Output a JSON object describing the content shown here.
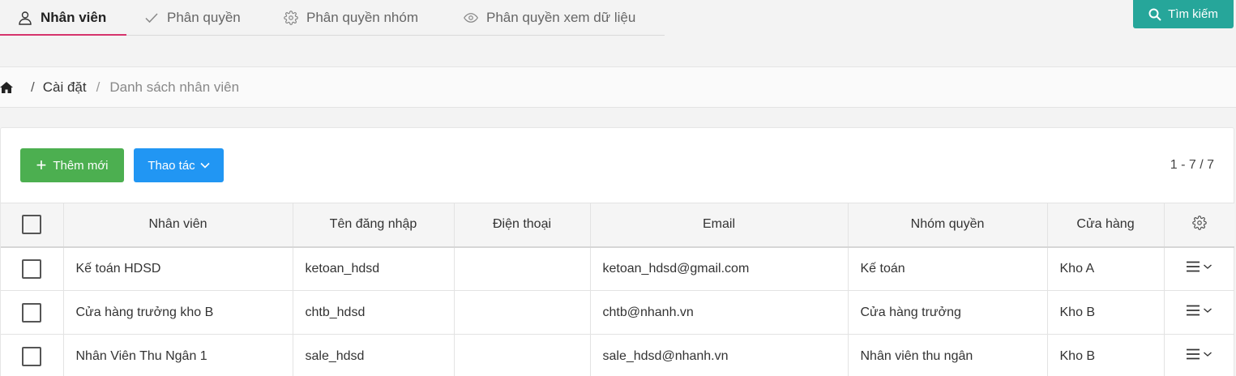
{
  "tabs": [
    {
      "label": "Nhân viên",
      "icon": "user-icon",
      "active": true
    },
    {
      "label": "Phân quyền",
      "icon": "check-icon",
      "active": false
    },
    {
      "label": "Phân quyền nhóm",
      "icon": "gear-icon",
      "active": false
    },
    {
      "label": "Phân quyền xem dữ liệu",
      "icon": "eye-icon",
      "active": false
    }
  ],
  "search_button": {
    "label": "Tìm kiếm",
    "icon": "search-icon"
  },
  "breadcrumb": {
    "icon": "home-icon",
    "link": "Cài đặt",
    "current": "Danh sách nhân viên"
  },
  "toolbar": {
    "add_label": "Thêm mới",
    "actions_label": "Thao tác",
    "pager": "1 - 7 / 7"
  },
  "table": {
    "columns": [
      "Nhân viên",
      "Tên đăng nhập",
      "Điện thoại",
      "Email",
      "Nhóm quyền",
      "Cửa hàng"
    ],
    "rows": [
      {
        "name": "Kế toán HDSD",
        "username": "ketoan_hdsd",
        "phone": "",
        "email": "ketoan_hdsd@gmail.com",
        "group": "Kế toán",
        "store": "Kho A"
      },
      {
        "name": "Cửa hàng trưởng kho B",
        "username": "chtb_hdsd",
        "phone": "",
        "email": "chtb@nhanh.vn",
        "group": "Cửa hàng trưởng",
        "store": "Kho B"
      },
      {
        "name": "Nhân Viên Thu Ngân 1",
        "username": "sale_hdsd",
        "phone": "",
        "email": "sale_hdsd@nhanh.vn",
        "group": "Nhân viên thu ngân",
        "store": "Kho B"
      }
    ]
  },
  "colors": {
    "active_tab": "#d6336c",
    "search": "#26a69a",
    "add": "#4caf50",
    "actions": "#2196f3"
  }
}
